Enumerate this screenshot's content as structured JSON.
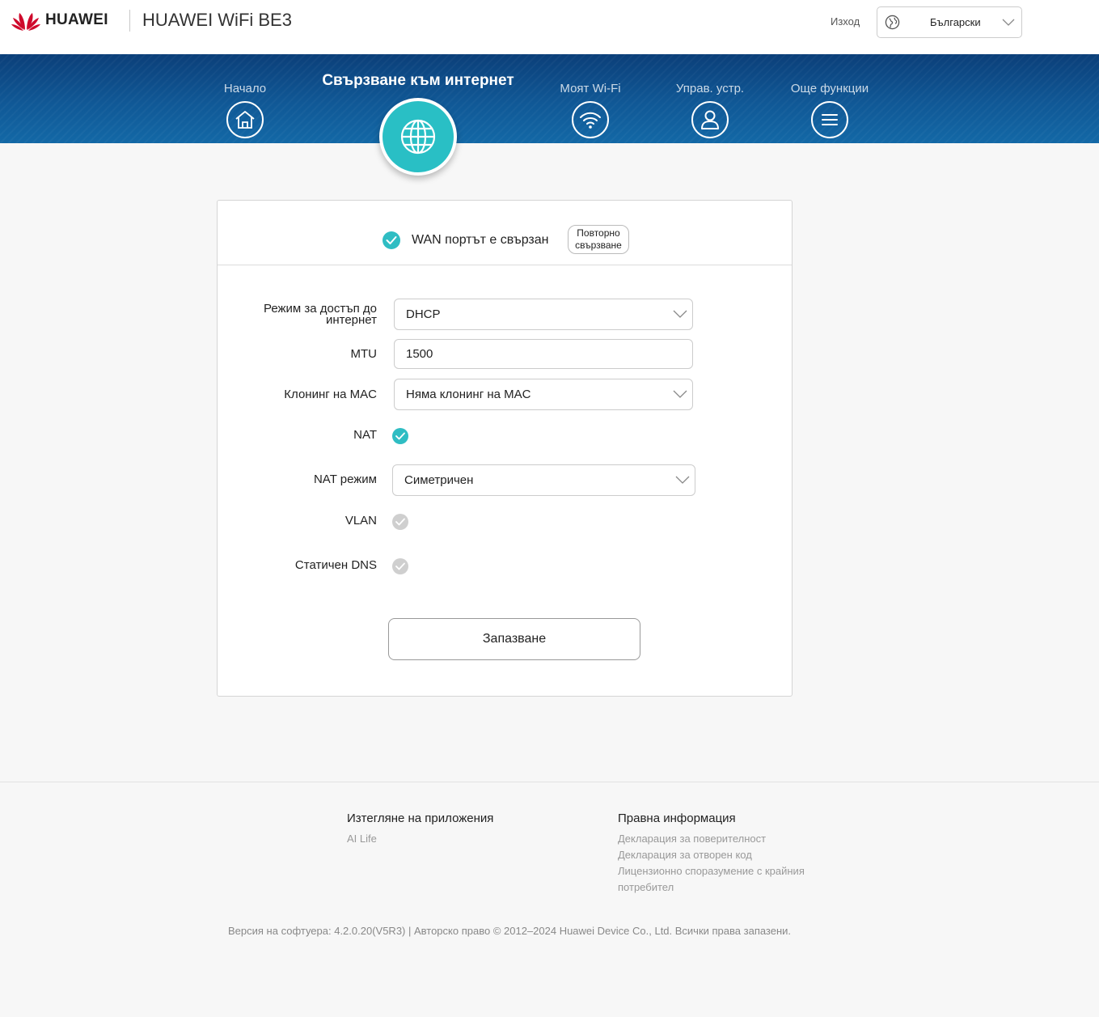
{
  "header": {
    "brand": "HUAWEI",
    "product": "HUAWEI WiFi BE3",
    "logout": "Изход",
    "language": "Български"
  },
  "nav": {
    "home": "Начало",
    "internet": "Свързване към интернет",
    "wifi": "Моят Wi-Fi",
    "devices": "Управ. устр.",
    "more": "Още функции"
  },
  "status": {
    "text": "WAN портът е свързан",
    "reconnect_line1": "Повторно",
    "reconnect_line2": "свързване"
  },
  "form": {
    "access_mode_label_line1": "Режим за достъп до",
    "access_mode_label_line2": "интернет",
    "access_mode_value": "DHCP",
    "mtu_label": "MTU",
    "mtu_value": "1500",
    "mac_label": "Клонинг на MAC",
    "mac_value": "Няма клонинг на MAC",
    "nat_label": "NAT",
    "nat_enabled": true,
    "nat_mode_label": "NAT режим",
    "nat_mode_value": "Симетричен",
    "vlan_label": "VLAN",
    "vlan_enabled": false,
    "dns_label": "Статичен DNS",
    "dns_enabled": false,
    "save": "Запазване"
  },
  "footer": {
    "apps_title": "Изтегляне на приложения",
    "apps_link": "AI Life",
    "legal_title": "Правна информация",
    "privacy": "Декларация за поверителност",
    "open_source": "Декларация за отворен код",
    "license_line1": "Лицензионно споразумение с крайния",
    "license_line2": "потребител",
    "copyright": "Версия на софтуера: 4.2.0.20(V5R3) |  Авторско право © 2012–2024 Huawei Device Co., Ltd. Всички права запазени."
  },
  "colors": {
    "accent": "#2fbdc3",
    "nav_dark": "#0b3f79",
    "nav_light": "#1368a6",
    "brand_red": "#cf0a2c"
  },
  "icons": {
    "brand": "huawei-flower-logo",
    "language": "globe-icon",
    "home": "house-icon",
    "internet": "globe-icon",
    "wifi": "wifi-icon",
    "devices": "user-icon",
    "more": "menu-icon"
  }
}
